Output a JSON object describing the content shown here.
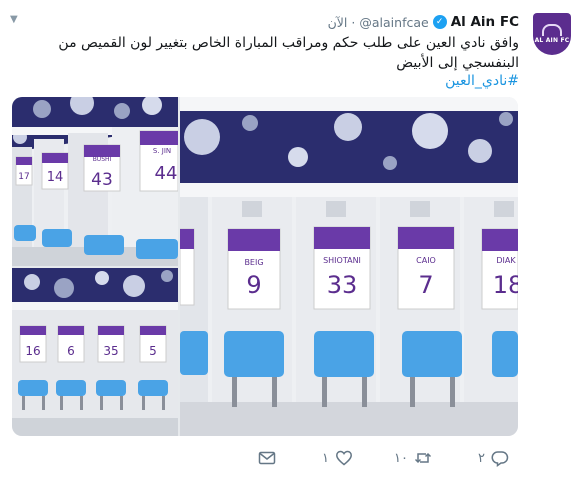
{
  "tweet": {
    "author_name": "Al Ain FC",
    "handle": "@alainfcae",
    "separator": "·",
    "time": "الآن",
    "text": "وافق نادي العين على طلب حكم ومراقب المباراة الخاص بتغيير لون القميص من البنفسجي إلى الأبيض",
    "hashtag": "#نادي_العين",
    "avatar_text": "AL AIN FC"
  },
  "media": {
    "jerseys_top_left": [
      "17",
      "14",
      "43",
      "44"
    ],
    "jerseys_bottom_left": [
      "16",
      "6",
      "35",
      "5"
    ],
    "jerseys_main": [
      {
        "name": "BEIG",
        "number": "9"
      },
      {
        "name": "SHIOTANI",
        "number": "33"
      },
      {
        "name": "CAIO",
        "number": "7"
      },
      {
        "name": "DIAK",
        "number": "18"
      }
    ],
    "top_left_names": [
      "",
      "BUSHI",
      "S. JIN"
    ],
    "colors": {
      "purple": "#6a3aa8",
      "seat_blue": "#4aa3e6",
      "wall": "#2b2d6e"
    }
  },
  "actions": {
    "replies": "٢",
    "retweets": "١٠",
    "likes": "١"
  },
  "icons": [
    "verified-icon",
    "caret-down-icon",
    "reply-icon",
    "retweet-icon",
    "like-icon",
    "dm-icon"
  ]
}
